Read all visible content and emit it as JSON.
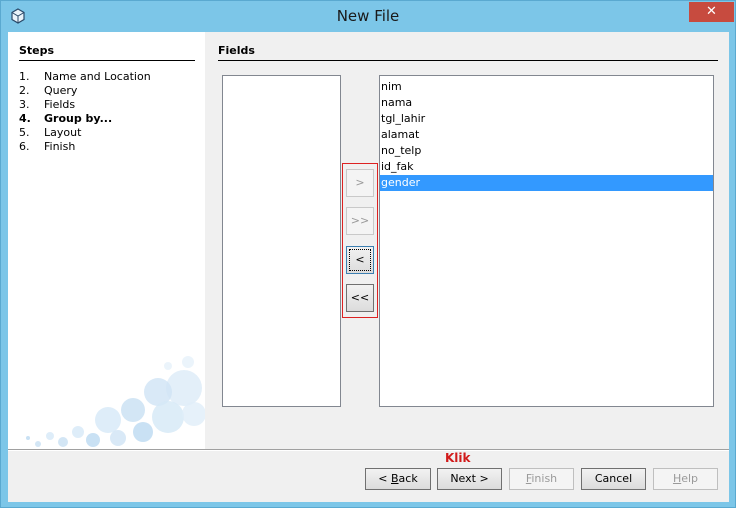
{
  "window": {
    "title": "New File",
    "close_glyph": "✕"
  },
  "steps": {
    "heading": "Steps",
    "items": [
      {
        "num": "1.",
        "label": "Name and Location"
      },
      {
        "num": "2.",
        "label": "Query"
      },
      {
        "num": "3.",
        "label": "Fields"
      },
      {
        "num": "4.",
        "label": "Group by..."
      },
      {
        "num": "5.",
        "label": "Layout"
      },
      {
        "num": "6.",
        "label": "Finish"
      }
    ],
    "current_index": 3
  },
  "fields": {
    "heading": "Fields",
    "available": [],
    "selected": [
      "nim",
      "nama",
      "tgl_lahir",
      "alamat",
      "no_telp",
      "id_fak",
      "gender"
    ],
    "selected_item": "gender"
  },
  "move_buttons": {
    "add": ">",
    "add_all": ">>",
    "remove": "<",
    "remove_all": "<<"
  },
  "annotation": "Klik",
  "footer": {
    "back_mnemonic": "B",
    "back_rest": "ack",
    "back_prefix": "< ",
    "next": "Next >",
    "finish_mnemonic": "F",
    "finish_rest": "inish",
    "cancel": "Cancel",
    "help_mnemonic": "H",
    "help_rest": "elp"
  },
  "colors": {
    "titlebar": "#7cc6e8",
    "close": "#c74b3f",
    "selection": "#3399ff",
    "annotation": "#d11a1a"
  }
}
